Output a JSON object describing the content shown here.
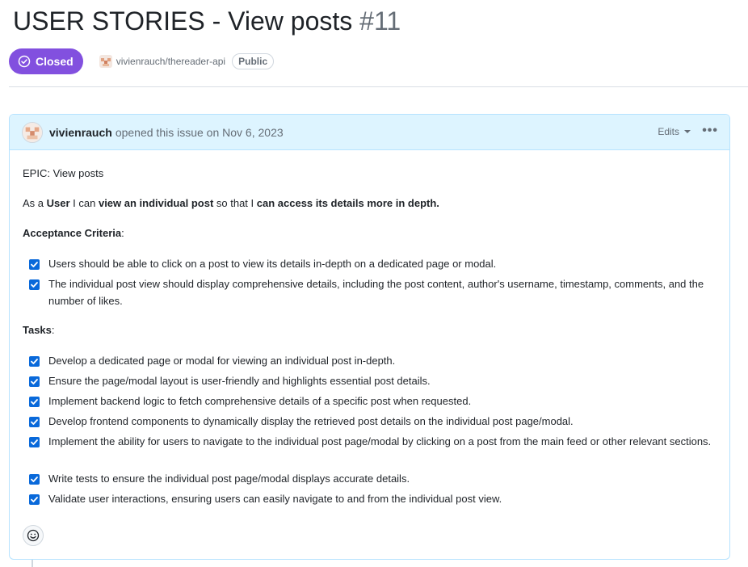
{
  "issue": {
    "title": "USER STORIES - View posts",
    "number": "#11",
    "state": "Closed",
    "repo": "vivienrauch/thereader-api",
    "visibility": "Public"
  },
  "comment": {
    "author": "vivienrauch",
    "opened_text": "opened this issue on Nov 6, 2023",
    "edits_label": "Edits",
    "more_label": "•••",
    "epic": "EPIC: View posts",
    "story": {
      "p1": "As a ",
      "b1": "User",
      "p2": " I can ",
      "b2": "view an individual post",
      "p3": " so that I ",
      "b3": "can access its details more in depth."
    },
    "acceptance_heading": "Acceptance Criteria",
    "acceptance_colon": ":",
    "acceptance": [
      {
        "text": "Users should be able to click on a post to view its details in-depth on a dedicated page or modal.",
        "checked": true
      },
      {
        "text": "The individual post view should display comprehensive details, including the post content, author's username, timestamp, comments, and the number of likes.",
        "checked": true
      }
    ],
    "tasks_heading": "Tasks",
    "tasks_colon": ":",
    "tasks": [
      {
        "text": "Develop a dedicated page or modal for viewing an individual post in-depth.",
        "checked": true
      },
      {
        "text": "Ensure the page/modal layout is user-friendly and highlights essential post details.",
        "checked": true
      },
      {
        "text": "Implement backend logic to fetch comprehensive details of a specific post when requested.",
        "checked": true
      },
      {
        "text": "Develop frontend components to dynamically display the retrieved post details on the individual post page/modal.",
        "checked": true
      },
      {
        "text": "Implement the ability for users to navigate to the individual post page/modal by clicking on a post from the main feed or other relevant sections.",
        "checked": true
      },
      {
        "text": "Write tests to ensure the individual post page/modal displays accurate details.",
        "checked": true
      },
      {
        "text": "Validate user interactions, ensuring users can easily navigate to and from the individual post view.",
        "checked": true
      }
    ]
  },
  "icons": {
    "state": "check-circle-icon",
    "reaction": "smiley-icon",
    "checkbox": "checkbox-checked-icon"
  },
  "colors": {
    "closed_purple": "#8250df",
    "checkbox_blue": "#0969da",
    "header_bg": "#ddf4ff",
    "border": "#b6e3ff"
  }
}
